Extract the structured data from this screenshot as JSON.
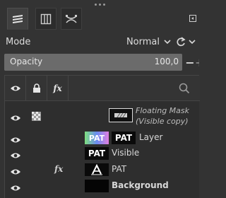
{
  "tabs": [
    {
      "name": "layers",
      "icon": "layers-stack-icon",
      "active": true
    },
    {
      "name": "channels",
      "icon": "channels-icon",
      "active": false
    },
    {
      "name": "paths",
      "icon": "paths-icon",
      "active": false
    }
  ],
  "mode": {
    "label": "Mode",
    "value": "Normal"
  },
  "opacity": {
    "label": "Opacity",
    "value": "100,0",
    "fraction": 1.0,
    "minus": "−",
    "plus": "+"
  },
  "header_icons": [
    "eye-icon",
    "lock-icon",
    "fx-icon",
    "search-icon"
  ],
  "header_fx": "fx",
  "floating_mask": {
    "line1": "Floating Mask",
    "line2": "(Visible copy)"
  },
  "layers": [
    {
      "name": "Layer",
      "thumb_text": "PAT",
      "thumb2_text": "PAT",
      "fx": false
    },
    {
      "name": "Visible",
      "thumb_text": "PAT",
      "fx": false
    },
    {
      "name": "PAT",
      "thumb_text": "",
      "fx": true,
      "fx_label": "fx"
    },
    {
      "name": "Background",
      "thumb_text": "",
      "fx": false
    }
  ],
  "colors": {
    "panel": "#333333",
    "list": "#2e2e2e",
    "header": "#343434"
  }
}
